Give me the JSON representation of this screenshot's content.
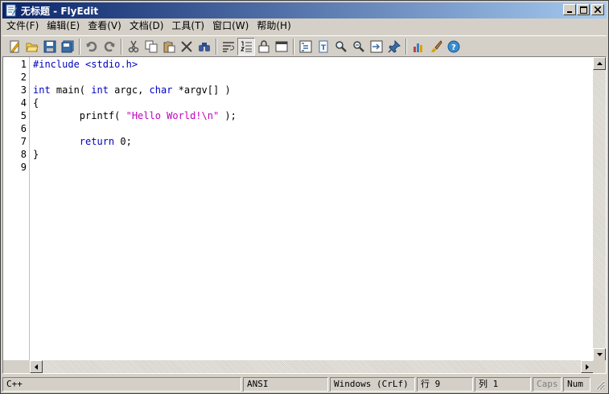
{
  "window": {
    "title": "无标题 - FlyEdit"
  },
  "menu": [
    {
      "label": "文件(F)"
    },
    {
      "label": "编辑(E)"
    },
    {
      "label": "查看(V)"
    },
    {
      "label": "文档(D)"
    },
    {
      "label": "工具(T)"
    },
    {
      "label": "窗口(W)"
    },
    {
      "label": "帮助(H)"
    }
  ],
  "toolbar": [
    "new-file-icon",
    "open-folder-icon",
    "save-icon",
    "save-all-icon",
    "|",
    "undo-icon",
    "redo-icon",
    "|",
    "cut-icon",
    "copy-icon",
    "paste-icon",
    "delete-icon",
    "find-icon",
    "|",
    "word-wrap-icon",
    "line-numbers-icon",
    "lock-icon",
    "fullscreen-icon",
    "|",
    "outline-icon",
    "document-icon",
    "zoom-in-icon",
    "zoom-out-icon",
    "goto-icon",
    "pin-icon",
    "|",
    "chart-icon",
    "brush-icon",
    "help-icon"
  ],
  "editor": {
    "line_numbers": [
      "1",
      "2",
      "3",
      "4",
      "5",
      "6",
      "7",
      "8",
      "9"
    ],
    "lines": [
      [
        {
          "t": "#include <stdio.h>",
          "c": "pp"
        }
      ],
      [],
      [
        {
          "t": "int",
          "c": "kw"
        },
        {
          "t": " main( "
        },
        {
          "t": "int",
          "c": "kw"
        },
        {
          "t": " argc, "
        },
        {
          "t": "char",
          "c": "kw"
        },
        {
          "t": " *argv[] )"
        }
      ],
      [
        {
          "t": "{"
        }
      ],
      [
        {
          "t": "        printf( "
        },
        {
          "t": "\"Hello World!\\n\"",
          "c": "str"
        },
        {
          "t": " );"
        }
      ],
      [],
      [
        {
          "t": "        "
        },
        {
          "t": "return",
          "c": "kw"
        },
        {
          "t": " 0;"
        }
      ],
      [
        {
          "t": "}"
        }
      ],
      []
    ]
  },
  "statusbar": {
    "language": "C++",
    "encoding": "ANSI",
    "line_ending": "Windows (CrLf)",
    "line": "行 9",
    "column": "列 1",
    "caps": "Caps",
    "num": "Num"
  }
}
